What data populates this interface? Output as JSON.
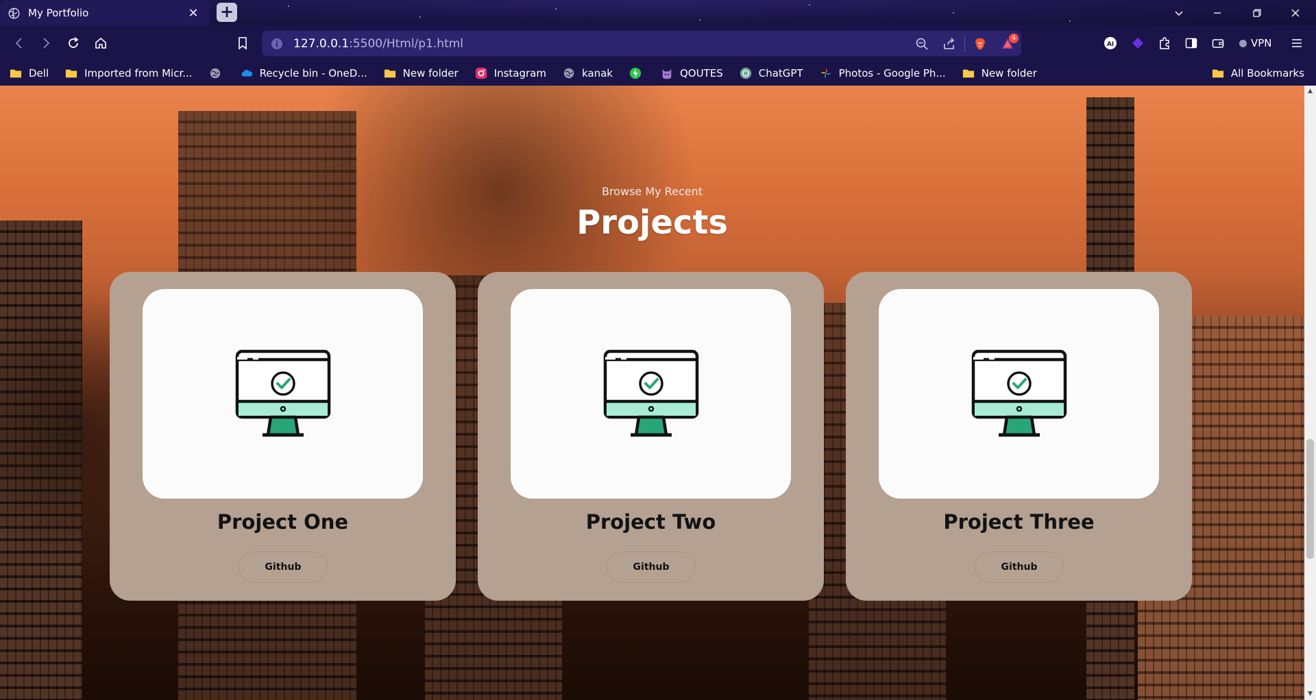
{
  "window": {
    "tab_title": "My Portfolio",
    "tab_close": "✕",
    "new_tab": "+",
    "controls": [
      "tab-search",
      "minimize",
      "restore",
      "close"
    ]
  },
  "navigation": {
    "url_host": "127.0.0.1",
    "url_path": ":5500/Html/p1.html",
    "alerts_count": "4",
    "vpn_label": "VPN"
  },
  "bookmarks": {
    "items": [
      {
        "label": "Dell",
        "icon": "folder-icon"
      },
      {
        "label": "Imported from Micr...",
        "icon": "folder-icon"
      },
      {
        "label": "",
        "icon": "globe-icon"
      },
      {
        "label": "Recycle bin - OneD...",
        "icon": "onedrive-icon"
      },
      {
        "label": "New folder",
        "icon": "folder-icon"
      },
      {
        "label": "Instagram",
        "icon": "instagram-icon"
      },
      {
        "label": "kanak",
        "icon": "globe-icon"
      },
      {
        "label": "",
        "icon": "bolt-icon"
      },
      {
        "label": "QOUTES",
        "icon": "cat-icon"
      },
      {
        "label": "ChatGPT",
        "icon": "chatgpt-icon"
      },
      {
        "label": "Photos - Google Ph...",
        "icon": "pinwheel-icon"
      },
      {
        "label": "New folder",
        "icon": "folder-icon"
      }
    ],
    "all_bookmarks": "All Bookmarks"
  },
  "page": {
    "subtitle": "Browse My Recent",
    "title": "Projects",
    "projects": [
      {
        "title": "Project One",
        "button": "Github",
        "icon": "monitor-check-icon"
      },
      {
        "title": "Project Two",
        "button": "Github",
        "icon": "monitor-check-icon"
      },
      {
        "title": "Project Three",
        "button": "Github",
        "icon": "monitor-check-icon"
      }
    ]
  },
  "colors": {
    "browser_chrome": "#1b1448",
    "url_bar": "#2d2470",
    "card_bg": "#b5a192",
    "thumb_bg": "#fbfbfb",
    "monitor_accent": "#7ee0c4",
    "check_green": "#2aa57a"
  }
}
